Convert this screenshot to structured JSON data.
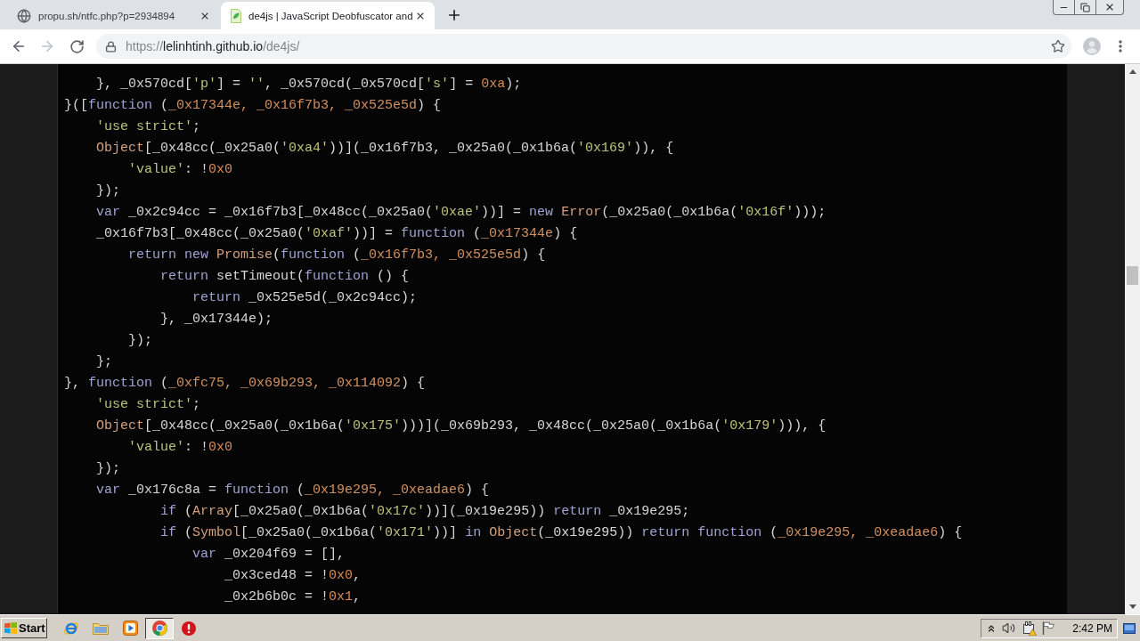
{
  "browser": {
    "tabs": [
      {
        "title": "propu.sh/ntfc.php?p=2934894",
        "selected": false
      },
      {
        "title": "de4js | JavaScript Deobfuscator and",
        "selected": true
      }
    ],
    "back": {
      "disabled": false
    },
    "forward": {
      "disabled": true
    },
    "address_bar": {
      "scheme": "https://",
      "host": "lelinhtinh.github.io",
      "path": "/de4js/",
      "bookmarked": false
    }
  },
  "code": {
    "lines": [
      {
        "tokens": [
          {
            "kind": "plain",
            "text": "    }, _0x570cd["
          },
          {
            "kind": "string",
            "text": "'p'"
          },
          {
            "kind": "plain",
            "text": "] = "
          },
          {
            "kind": "string",
            "text": "''"
          },
          {
            "kind": "plain",
            "text": ", _0x570cd(_0x570cd["
          },
          {
            "kind": "string",
            "text": "'s'"
          },
          {
            "kind": "plain",
            "text": "] = "
          },
          {
            "kind": "number",
            "text": "0xa"
          },
          {
            "kind": "plain",
            "text": ");"
          }
        ]
      },
      {
        "tokens": [
          {
            "kind": "plain",
            "text": "}(["
          },
          {
            "kind": "keyword",
            "text": "function"
          },
          {
            "kind": "plain",
            "text": " ("
          },
          {
            "kind": "param",
            "text": "_0x17344e, _0x16f7b3, _0x525e5d"
          },
          {
            "kind": "plain",
            "text": ") {"
          }
        ]
      },
      {
        "tokens": [
          {
            "kind": "string",
            "text": "    'use strict'"
          },
          {
            "kind": "plain",
            "text": ";"
          }
        ]
      },
      {
        "tokens": [
          {
            "kind": "builtin",
            "text": "    Object"
          },
          {
            "kind": "plain",
            "text": "[_0x48cc(_0x25a0("
          },
          {
            "kind": "string",
            "text": "'0xa4'"
          },
          {
            "kind": "plain",
            "text": "))](_0x16f7b3, _0x25a0(_0x1b6a("
          },
          {
            "kind": "string",
            "text": "'0x169'"
          },
          {
            "kind": "plain",
            "text": ")), {"
          }
        ]
      },
      {
        "tokens": [
          {
            "kind": "string",
            "text": "        'value'"
          },
          {
            "kind": "plain",
            "text": ": !"
          },
          {
            "kind": "number",
            "text": "0x0"
          }
        ]
      },
      {
        "tokens": [
          {
            "kind": "plain",
            "text": "    });"
          }
        ]
      },
      {
        "tokens": [
          {
            "kind": "keyword",
            "text": "    var"
          },
          {
            "kind": "plain",
            "text": " _0x2c94cc = _0x16f7b3[_0x48cc(_0x25a0("
          },
          {
            "kind": "string",
            "text": "'0xae'"
          },
          {
            "kind": "plain",
            "text": "))] = "
          },
          {
            "kind": "keyword",
            "text": "new "
          },
          {
            "kind": "builtin",
            "text": "Error"
          },
          {
            "kind": "plain",
            "text": "(_0x25a0(_0x1b6a("
          },
          {
            "kind": "string",
            "text": "'0x16f'"
          },
          {
            "kind": "plain",
            "text": ")));"
          }
        ]
      },
      {
        "tokens": [
          {
            "kind": "plain",
            "text": "    _0x16f7b3[_0x48cc(_0x25a0("
          },
          {
            "kind": "string",
            "text": "'0xaf'"
          },
          {
            "kind": "plain",
            "text": "))] = "
          },
          {
            "kind": "keyword",
            "text": "function"
          },
          {
            "kind": "plain",
            "text": " ("
          },
          {
            "kind": "param",
            "text": "_0x17344e"
          },
          {
            "kind": "plain",
            "text": ") {"
          }
        ]
      },
      {
        "tokens": [
          {
            "kind": "keyword",
            "text": "        return new "
          },
          {
            "kind": "builtin",
            "text": "Promise"
          },
          {
            "kind": "plain",
            "text": "("
          },
          {
            "kind": "keyword",
            "text": "function"
          },
          {
            "kind": "plain",
            "text": " ("
          },
          {
            "kind": "param",
            "text": "_0x16f7b3, _0x525e5d"
          },
          {
            "kind": "plain",
            "text": ") {"
          }
        ]
      },
      {
        "tokens": [
          {
            "kind": "keyword",
            "text": "            return"
          },
          {
            "kind": "plain",
            "text": " setTimeout("
          },
          {
            "kind": "keyword",
            "text": "function"
          },
          {
            "kind": "plain",
            "text": " () {"
          }
        ]
      },
      {
        "tokens": [
          {
            "kind": "keyword",
            "text": "                return"
          },
          {
            "kind": "plain",
            "text": " _0x525e5d(_0x2c94cc);"
          }
        ]
      },
      {
        "tokens": [
          {
            "kind": "plain",
            "text": "            }, _0x17344e);"
          }
        ]
      },
      {
        "tokens": [
          {
            "kind": "plain",
            "text": "        });"
          }
        ]
      },
      {
        "tokens": [
          {
            "kind": "plain",
            "text": "    };"
          }
        ]
      },
      {
        "tokens": [
          {
            "kind": "plain",
            "text": "}, "
          },
          {
            "kind": "keyword",
            "text": "function"
          },
          {
            "kind": "plain",
            "text": " ("
          },
          {
            "kind": "param",
            "text": "_0xfc75, _0x69b293, _0x114092"
          },
          {
            "kind": "plain",
            "text": ") {"
          }
        ]
      },
      {
        "tokens": [
          {
            "kind": "string",
            "text": "    'use strict'"
          },
          {
            "kind": "plain",
            "text": ";"
          }
        ]
      },
      {
        "tokens": [
          {
            "kind": "builtin",
            "text": "    Object"
          },
          {
            "kind": "plain",
            "text": "[_0x48cc(_0x25a0(_0x1b6a("
          },
          {
            "kind": "string",
            "text": "'0x175'"
          },
          {
            "kind": "plain",
            "text": ")))](_0x69b293, _0x48cc(_0x25a0(_0x1b6a("
          },
          {
            "kind": "string",
            "text": "'0x179'"
          },
          {
            "kind": "plain",
            "text": "))), {"
          }
        ]
      },
      {
        "tokens": [
          {
            "kind": "string",
            "text": "        'value'"
          },
          {
            "kind": "plain",
            "text": ": !"
          },
          {
            "kind": "number",
            "text": "0x0"
          }
        ]
      },
      {
        "tokens": [
          {
            "kind": "plain",
            "text": "    });"
          }
        ]
      },
      {
        "tokens": [
          {
            "kind": "keyword",
            "text": "    var"
          },
          {
            "kind": "plain",
            "text": " _0x176c8a = "
          },
          {
            "kind": "keyword",
            "text": "function"
          },
          {
            "kind": "plain",
            "text": " ("
          },
          {
            "kind": "param",
            "text": "_0x19e295, _0xeadae6"
          },
          {
            "kind": "plain",
            "text": ") {"
          }
        ]
      },
      {
        "tokens": [
          {
            "kind": "keyword",
            "text": "            if"
          },
          {
            "kind": "plain",
            "text": " ("
          },
          {
            "kind": "builtin",
            "text": "Array"
          },
          {
            "kind": "plain",
            "text": "[_0x25a0(_0x1b6a("
          },
          {
            "kind": "string",
            "text": "'0x17c'"
          },
          {
            "kind": "plain",
            "text": "))](_0x19e295)) "
          },
          {
            "kind": "keyword",
            "text": "return"
          },
          {
            "kind": "plain",
            "text": " _0x19e295;"
          }
        ]
      },
      {
        "tokens": [
          {
            "kind": "keyword",
            "text": "            if"
          },
          {
            "kind": "plain",
            "text": " ("
          },
          {
            "kind": "builtin",
            "text": "Symbol"
          },
          {
            "kind": "plain",
            "text": "[_0x25a0(_0x1b6a("
          },
          {
            "kind": "string",
            "text": "'0x171'"
          },
          {
            "kind": "plain",
            "text": "))] "
          },
          {
            "kind": "keyword",
            "text": "in "
          },
          {
            "kind": "builtin",
            "text": "Object"
          },
          {
            "kind": "plain",
            "text": "(_0x19e295)) "
          },
          {
            "kind": "keyword",
            "text": "return function"
          },
          {
            "kind": "plain",
            "text": " ("
          },
          {
            "kind": "param",
            "text": "_0x19e295, _0xeadae6"
          },
          {
            "kind": "plain",
            "text": ") {"
          }
        ]
      },
      {
        "tokens": [
          {
            "kind": "keyword",
            "text": "                var"
          },
          {
            "kind": "plain",
            "text": " _0x204f69 = [],"
          }
        ]
      },
      {
        "tokens": [
          {
            "kind": "plain",
            "text": "                    _0x3ced48 = !"
          },
          {
            "kind": "number",
            "text": "0x0"
          },
          {
            "kind": "plain",
            "text": ","
          }
        ]
      },
      {
        "tokens": [
          {
            "kind": "plain",
            "text": "                    _0x2b6b0c = !"
          },
          {
            "kind": "number",
            "text": "0x1"
          },
          {
            "kind": "plain",
            "text": ","
          }
        ]
      }
    ]
  },
  "taskbar": {
    "start_label": "Start",
    "apps": [
      {
        "selected": false
      },
      {
        "selected": false
      },
      {
        "selected": false
      },
      {
        "selected": true
      },
      {
        "selected": false
      }
    ],
    "clock": "2:42 PM"
  }
}
